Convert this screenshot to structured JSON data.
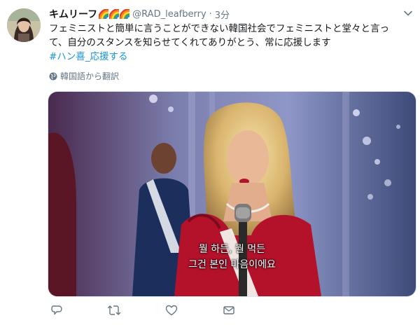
{
  "tweet": {
    "display_name": "キムリーフ",
    "handle": "@RAD_leafberry",
    "separator": "·",
    "time": "3分",
    "text_line1": "フェミニストと簡単に言うことができない韓国社会でフェミニストと堂々と言っ",
    "text_line2": "て、自分のスタンスを知らせてくれてありがとう、常に応援します",
    "hashtag": "#ハン喜",
    "hashtag_suffix": "_応援する",
    "translate_label": "韓国語から翻訳"
  },
  "media": {
    "subtitle_line1": "뭘 하든, 뭘 먹든",
    "subtitle_line2": "그건 본인 마음이에요"
  },
  "icons": {
    "reply": "reply-icon",
    "retweet": "retweet-icon",
    "like": "heart-icon",
    "dm": "mail-icon",
    "more": "chevron-down-icon",
    "globe": "globe-icon"
  },
  "colors": {
    "link": "#1b95e0",
    "secondary_text": "#657786",
    "dress_red": "#b3122a"
  }
}
